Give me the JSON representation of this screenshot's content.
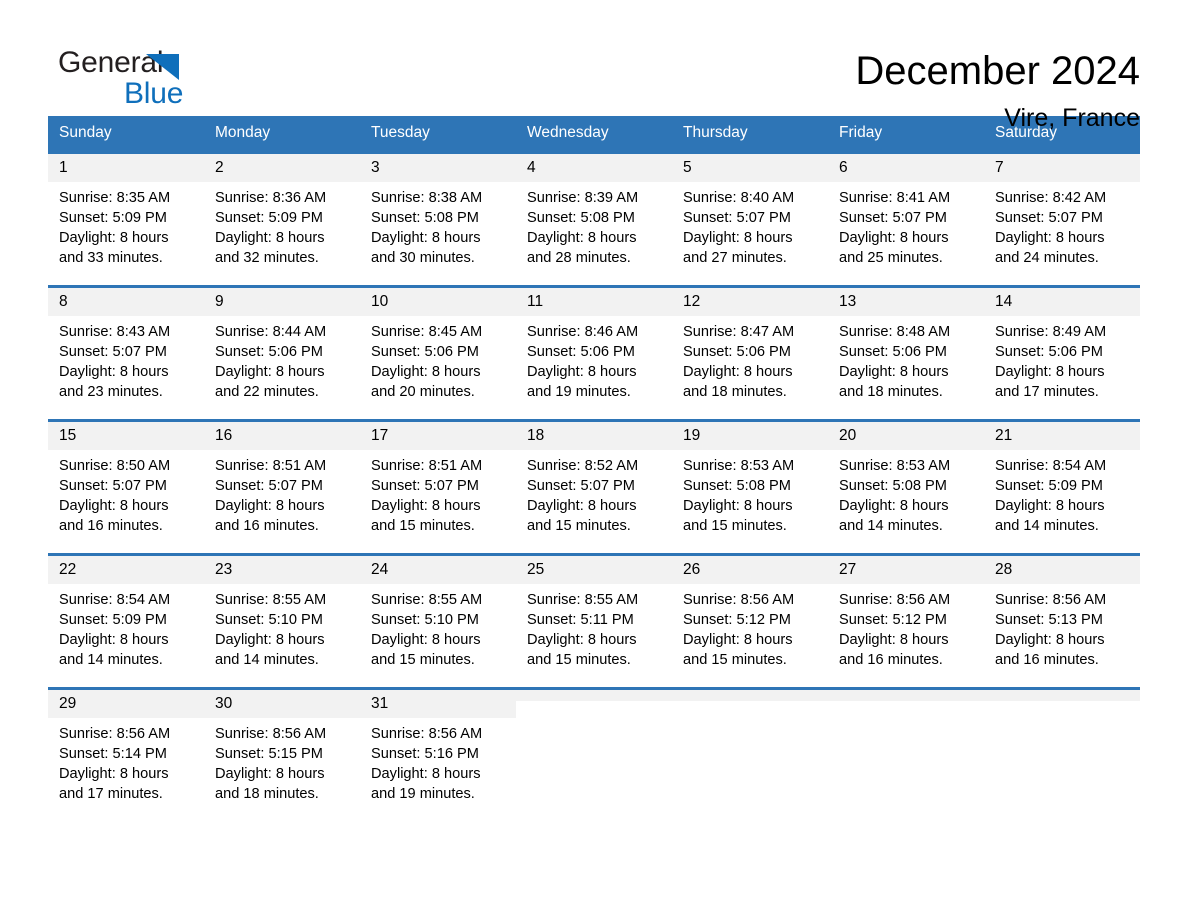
{
  "brand": {
    "logo_text_1": "General",
    "logo_text_2": "Blue",
    "logo_accent_color": "#0f6fbb"
  },
  "header": {
    "title": "December 2024",
    "location": "Vire, France"
  },
  "theme": {
    "header_bg": "#2e75b6",
    "day_number_bg": "#f2f2f2",
    "row_border": "#2e75b6"
  },
  "calendar": {
    "weekday_headers": [
      "Sunday",
      "Monday",
      "Tuesday",
      "Wednesday",
      "Thursday",
      "Friday",
      "Saturday"
    ],
    "weeks": [
      [
        {
          "day": "1",
          "sunrise": "Sunrise: 8:35 AM",
          "sunset": "Sunset: 5:09 PM",
          "daylight": "Daylight: 8 hours and 33 minutes."
        },
        {
          "day": "2",
          "sunrise": "Sunrise: 8:36 AM",
          "sunset": "Sunset: 5:09 PM",
          "daylight": "Daylight: 8 hours and 32 minutes."
        },
        {
          "day": "3",
          "sunrise": "Sunrise: 8:38 AM",
          "sunset": "Sunset: 5:08 PM",
          "daylight": "Daylight: 8 hours and 30 minutes."
        },
        {
          "day": "4",
          "sunrise": "Sunrise: 8:39 AM",
          "sunset": "Sunset: 5:08 PM",
          "daylight": "Daylight: 8 hours and 28 minutes."
        },
        {
          "day": "5",
          "sunrise": "Sunrise: 8:40 AM",
          "sunset": "Sunset: 5:07 PM",
          "daylight": "Daylight: 8 hours and 27 minutes."
        },
        {
          "day": "6",
          "sunrise": "Sunrise: 8:41 AM",
          "sunset": "Sunset: 5:07 PM",
          "daylight": "Daylight: 8 hours and 25 minutes."
        },
        {
          "day": "7",
          "sunrise": "Sunrise: 8:42 AM",
          "sunset": "Sunset: 5:07 PM",
          "daylight": "Daylight: 8 hours and 24 minutes."
        }
      ],
      [
        {
          "day": "8",
          "sunrise": "Sunrise: 8:43 AM",
          "sunset": "Sunset: 5:07 PM",
          "daylight": "Daylight: 8 hours and 23 minutes."
        },
        {
          "day": "9",
          "sunrise": "Sunrise: 8:44 AM",
          "sunset": "Sunset: 5:06 PM",
          "daylight": "Daylight: 8 hours and 22 minutes."
        },
        {
          "day": "10",
          "sunrise": "Sunrise: 8:45 AM",
          "sunset": "Sunset: 5:06 PM",
          "daylight": "Daylight: 8 hours and 20 minutes."
        },
        {
          "day": "11",
          "sunrise": "Sunrise: 8:46 AM",
          "sunset": "Sunset: 5:06 PM",
          "daylight": "Daylight: 8 hours and 19 minutes."
        },
        {
          "day": "12",
          "sunrise": "Sunrise: 8:47 AM",
          "sunset": "Sunset: 5:06 PM",
          "daylight": "Daylight: 8 hours and 18 minutes."
        },
        {
          "day": "13",
          "sunrise": "Sunrise: 8:48 AM",
          "sunset": "Sunset: 5:06 PM",
          "daylight": "Daylight: 8 hours and 18 minutes."
        },
        {
          "day": "14",
          "sunrise": "Sunrise: 8:49 AM",
          "sunset": "Sunset: 5:06 PM",
          "daylight": "Daylight: 8 hours and 17 minutes."
        }
      ],
      [
        {
          "day": "15",
          "sunrise": "Sunrise: 8:50 AM",
          "sunset": "Sunset: 5:07 PM",
          "daylight": "Daylight: 8 hours and 16 minutes."
        },
        {
          "day": "16",
          "sunrise": "Sunrise: 8:51 AM",
          "sunset": "Sunset: 5:07 PM",
          "daylight": "Daylight: 8 hours and 16 minutes."
        },
        {
          "day": "17",
          "sunrise": "Sunrise: 8:51 AM",
          "sunset": "Sunset: 5:07 PM",
          "daylight": "Daylight: 8 hours and 15 minutes."
        },
        {
          "day": "18",
          "sunrise": "Sunrise: 8:52 AM",
          "sunset": "Sunset: 5:07 PM",
          "daylight": "Daylight: 8 hours and 15 minutes."
        },
        {
          "day": "19",
          "sunrise": "Sunrise: 8:53 AM",
          "sunset": "Sunset: 5:08 PM",
          "daylight": "Daylight: 8 hours and 15 minutes."
        },
        {
          "day": "20",
          "sunrise": "Sunrise: 8:53 AM",
          "sunset": "Sunset: 5:08 PM",
          "daylight": "Daylight: 8 hours and 14 minutes."
        },
        {
          "day": "21",
          "sunrise": "Sunrise: 8:54 AM",
          "sunset": "Sunset: 5:09 PM",
          "daylight": "Daylight: 8 hours and 14 minutes."
        }
      ],
      [
        {
          "day": "22",
          "sunrise": "Sunrise: 8:54 AM",
          "sunset": "Sunset: 5:09 PM",
          "daylight": "Daylight: 8 hours and 14 minutes."
        },
        {
          "day": "23",
          "sunrise": "Sunrise: 8:55 AM",
          "sunset": "Sunset: 5:10 PM",
          "daylight": "Daylight: 8 hours and 14 minutes."
        },
        {
          "day": "24",
          "sunrise": "Sunrise: 8:55 AM",
          "sunset": "Sunset: 5:10 PM",
          "daylight": "Daylight: 8 hours and 15 minutes."
        },
        {
          "day": "25",
          "sunrise": "Sunrise: 8:55 AM",
          "sunset": "Sunset: 5:11 PM",
          "daylight": "Daylight: 8 hours and 15 minutes."
        },
        {
          "day": "26",
          "sunrise": "Sunrise: 8:56 AM",
          "sunset": "Sunset: 5:12 PM",
          "daylight": "Daylight: 8 hours and 15 minutes."
        },
        {
          "day": "27",
          "sunrise": "Sunrise: 8:56 AM",
          "sunset": "Sunset: 5:12 PM",
          "daylight": "Daylight: 8 hours and 16 minutes."
        },
        {
          "day": "28",
          "sunrise": "Sunrise: 8:56 AM",
          "sunset": "Sunset: 5:13 PM",
          "daylight": "Daylight: 8 hours and 16 minutes."
        }
      ],
      [
        {
          "day": "29",
          "sunrise": "Sunrise: 8:56 AM",
          "sunset": "Sunset: 5:14 PM",
          "daylight": "Daylight: 8 hours and 17 minutes."
        },
        {
          "day": "30",
          "sunrise": "Sunrise: 8:56 AM",
          "sunset": "Sunset: 5:15 PM",
          "daylight": "Daylight: 8 hours and 18 minutes."
        },
        {
          "day": "31",
          "sunrise": "Sunrise: 8:56 AM",
          "sunset": "Sunset: 5:16 PM",
          "daylight": "Daylight: 8 hours and 19 minutes."
        },
        {
          "day": "",
          "sunrise": "",
          "sunset": "",
          "daylight": ""
        },
        {
          "day": "",
          "sunrise": "",
          "sunset": "",
          "daylight": ""
        },
        {
          "day": "",
          "sunrise": "",
          "sunset": "",
          "daylight": ""
        },
        {
          "day": "",
          "sunrise": "",
          "sunset": "",
          "daylight": ""
        }
      ]
    ]
  }
}
